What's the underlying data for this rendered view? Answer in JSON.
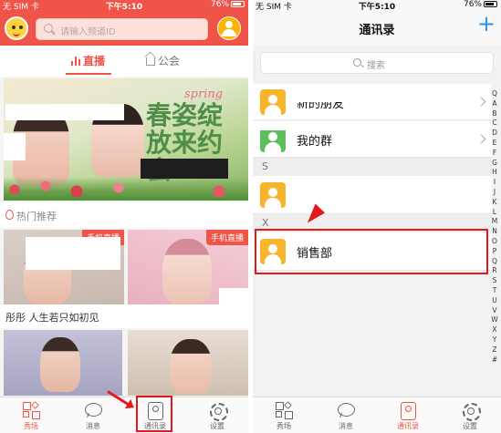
{
  "left_screen": {
    "status": {
      "carrier": "无 SIM 卡 ",
      "time": "下午5:10",
      "battery": "76%"
    },
    "search": {
      "placeholder": "请输入频道ID"
    },
    "tabs": [
      {
        "label": "直播",
        "active": true
      },
      {
        "label": "公会",
        "active": false
      }
    ],
    "banner": {
      "spring": "spring",
      "title": "春姿绽放来约会"
    },
    "hot_section": {
      "label": "热门推荐"
    },
    "cards": [
      {
        "badge": "手机直播"
      },
      {
        "badge": "手机直播"
      }
    ],
    "caption": "彤彤 人生若只如初见",
    "tabbar": [
      {
        "label": "秀场",
        "icon": "grid-icon",
        "active": true
      },
      {
        "label": "消息",
        "icon": "chat-icon",
        "active": false
      },
      {
        "label": "通讯录",
        "icon": "contacts-icon",
        "active": false
      },
      {
        "label": "设置",
        "icon": "gear-icon",
        "active": false
      }
    ]
  },
  "right_screen": {
    "status": {
      "carrier": "无 SIM 卡 ",
      "time": "下午5:10",
      "battery": "76%"
    },
    "header": {
      "title": "通讯录",
      "add_icon": "+"
    },
    "search": {
      "placeholder": "搜索"
    },
    "rows": [
      {
        "name": "新的朋友",
        "icon": "user-icon"
      },
      {
        "name": "我的群",
        "icon": "group-icon"
      }
    ],
    "sections": [
      {
        "letter": "S",
        "contacts": [
          {
            "name": ""
          }
        ]
      },
      {
        "letter": "X",
        "contacts": [
          {
            "name": "销售部"
          }
        ]
      }
    ],
    "index_letters": [
      "Q",
      "A",
      "B",
      "C",
      "D",
      "E",
      "F",
      "G",
      "H",
      "I",
      "J",
      "K",
      "L",
      "M",
      "N",
      "O",
      "P",
      "Q",
      "R",
      "S",
      "T",
      "U",
      "V",
      "W",
      "X",
      "Y",
      "Z",
      "#"
    ],
    "tabbar": [
      {
        "label": "秀场",
        "icon": "grid-icon",
        "active": false
      },
      {
        "label": "消息",
        "icon": "chat-icon",
        "active": false
      },
      {
        "label": "通讯录",
        "icon": "contacts-icon",
        "active": true
      },
      {
        "label": "设置",
        "icon": "gear-icon",
        "active": false
      }
    ]
  },
  "colors": {
    "primary_red": "#ef5448",
    "annotation_red": "#e01a1a",
    "accent_blue": "#2a8ff0",
    "avatar_orange": "#f7b52c"
  }
}
